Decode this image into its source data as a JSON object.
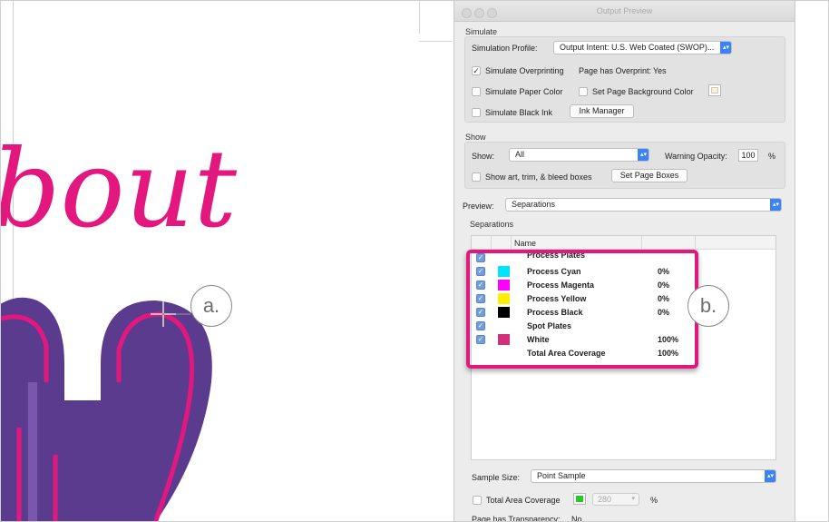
{
  "window": {
    "title": "Output Preview"
  },
  "artwork": {
    "text": "bout",
    "accent_color": "#e3187f",
    "heart_color": "#5b3b8e"
  },
  "callouts": {
    "a": "a.",
    "b": "b."
  },
  "simulate": {
    "section_title": "Simulate",
    "profile_label": "Simulation Profile:",
    "profile_value": "Output Intent: U.S. Web Coated (SWOP)...",
    "overprint_label": "Simulate Overprinting",
    "overprint_checked": true,
    "page_overprint_label": "Page has Overprint:",
    "page_overprint_value": "Yes",
    "paper_color_label": "Simulate Paper Color",
    "bg_color_label": "Set Page Background Color",
    "black_ink_label": "Simulate Black Ink",
    "ink_manager_button": "Ink Manager"
  },
  "show": {
    "section_title": "Show",
    "show_label": "Show:",
    "show_value": "All",
    "warning_label": "Warning Opacity:",
    "warning_value": "100",
    "warning_unit": "%",
    "art_trim_label": "Show art, trim, & bleed boxes",
    "page_boxes_button": "Set Page Boxes"
  },
  "preview": {
    "label": "Preview:",
    "value": "Separations"
  },
  "separations": {
    "section_title": "Separations",
    "name_header": "Name",
    "rows": [
      {
        "name": "Process Plates",
        "value": "",
        "color": ""
      },
      {
        "name": "Process Cyan",
        "value": "0%",
        "color": "#00e5ff"
      },
      {
        "name": "Process Magenta",
        "value": "0%",
        "color": "#ff00ff"
      },
      {
        "name": "Process Yellow",
        "value": "0%",
        "color": "#ffee00"
      },
      {
        "name": "Process Black",
        "value": "0%",
        "color": "#000000"
      },
      {
        "name": "Spot Plates",
        "value": "",
        "color": ""
      },
      {
        "name": "White",
        "value": "100%",
        "color": "#d2307a"
      },
      {
        "name": "Total Area Coverage",
        "value": "100%",
        "color": ""
      }
    ]
  },
  "sample": {
    "label": "Sample Size:",
    "value": "Point Sample"
  },
  "total_area": {
    "label": "Total Area Coverage",
    "value": "280",
    "unit": "%",
    "swatch_color": "#22cc22"
  },
  "transparency": {
    "label": "Page has Transparency:",
    "value": "No"
  }
}
